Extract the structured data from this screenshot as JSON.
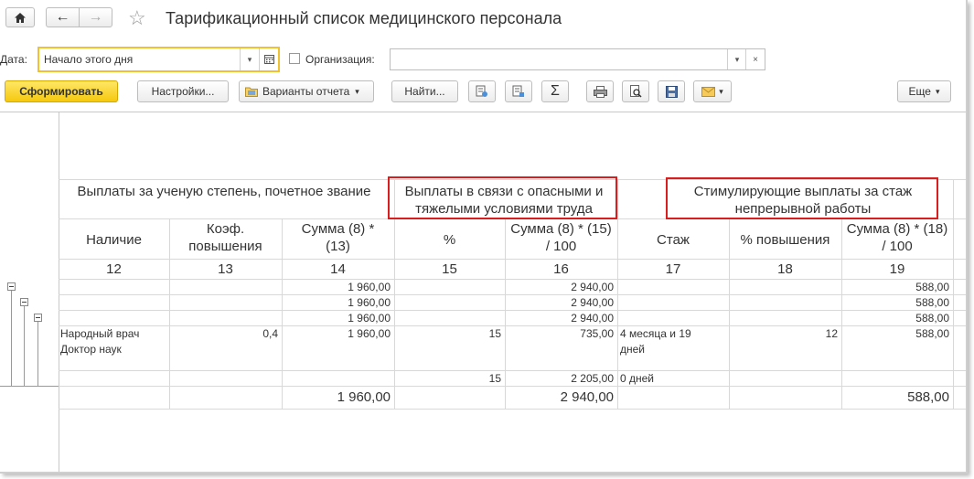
{
  "window": {
    "title": "Тарификационный список медицинского персонала"
  },
  "filters": {
    "date_label": "Дата:",
    "date_value": "Начало этого дня",
    "org_label": "Организация:",
    "org_value": ""
  },
  "toolbar": {
    "generate": "Сформировать",
    "settings": "Настройки...",
    "variants": "Варианты отчета",
    "find": "Найти...",
    "more": "Еще"
  },
  "report": {
    "groups": [
      {
        "text": "Выплаты за ученую степень, почетное звание"
      },
      {
        "text": "Выплаты в связи с опасными и тяжелыми условиями труда"
      },
      {
        "text": "Стимулирующие выплаты за стаж непрерывной работы"
      }
    ],
    "columns": [
      {
        "label": "Наличие",
        "num": "12"
      },
      {
        "label": "Коэф. повышения",
        "num": "13"
      },
      {
        "label": "Сумма (8) * (13)",
        "num": "14"
      },
      {
        "label": "%",
        "num": "15"
      },
      {
        "label": "Сумма (8) * (15) / 100",
        "num": "16"
      },
      {
        "label": "Стаж",
        "num": "17"
      },
      {
        "label": "% повышения",
        "num": "18"
      },
      {
        "label": "Сумма (8) * (18) / 100",
        "num": "19"
      }
    ],
    "rows": [
      {
        "c14": "1 960,00",
        "c16": "2 940,00",
        "c19": "588,00"
      },
      {
        "c14": "1 960,00",
        "c16": "2 940,00",
        "c19": "588,00"
      },
      {
        "c14": "1 960,00",
        "c16": "2 940,00",
        "c19": "588,00"
      },
      {
        "c12a": "Народный врач",
        "c12b": "Доктор наук",
        "c13": "0,4",
        "c14": "1 960,00",
        "c15": "15",
        "c16": "735,00",
        "c17a": "4 месяца и 19",
        "c17b": "дней",
        "c18": "12",
        "c19": "588,00"
      },
      {
        "c15": "15",
        "c16": "2 205,00",
        "c17a": "0 дней"
      }
    ],
    "totals": {
      "c14": "1 960,00",
      "c16": "2 940,00",
      "c19": "588,00"
    }
  }
}
